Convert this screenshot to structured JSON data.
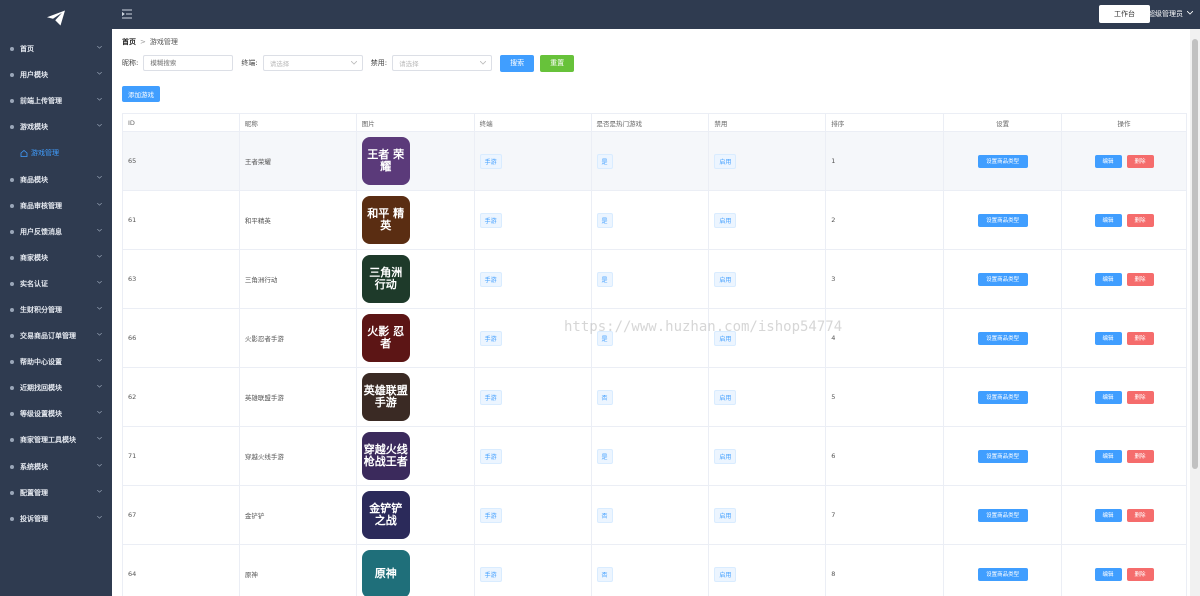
{
  "sidebar": {
    "items": [
      {
        "label": "首页",
        "active": false
      },
      {
        "label": "用户模块",
        "active": false
      },
      {
        "label": "前端上传管理",
        "active": false
      },
      {
        "label": "游戏模块",
        "active": false
      },
      {
        "label": "游戏管理",
        "active": true
      },
      {
        "label": "商品模块",
        "active": false
      },
      {
        "label": "商品审核管理",
        "active": false
      },
      {
        "label": "用户反馈消息",
        "active": false
      },
      {
        "label": "商家模块",
        "active": false
      },
      {
        "label": "实名认证",
        "active": false
      },
      {
        "label": "生财积分管理",
        "active": false
      },
      {
        "label": "交易商品订单管理",
        "active": false
      },
      {
        "label": "帮助中心设置",
        "active": false
      },
      {
        "label": "近期找回模块",
        "active": false
      },
      {
        "label": "等级设置模块",
        "active": false
      },
      {
        "label": "商家管理工具模块",
        "active": false
      },
      {
        "label": "系统模块",
        "active": false
      },
      {
        "label": "配置管理",
        "active": false
      },
      {
        "label": "投诉管理",
        "active": false
      }
    ]
  },
  "topbar": {
    "workbench": "工作台",
    "admin": "超级管理员"
  },
  "breadcrumb": {
    "home": "首页",
    "current": "游戏管理"
  },
  "filters": {
    "name_label": "昵称:",
    "name_placeholder": "模糊搜索",
    "terminal_label": "终端:",
    "terminal_placeholder": "请选择",
    "disable_label": "禁用:",
    "disable_placeholder": "请选择",
    "search_btn": "搜索",
    "reset_btn": "重置"
  },
  "add_btn": "添加游戏",
  "table": {
    "headers": [
      "ID",
      "昵称",
      "图片",
      "终端",
      "是否是热门游戏",
      "禁用",
      "排序",
      "设置",
      "操作"
    ],
    "set_label": "设置商品类型",
    "edit_label": "编辑",
    "delete_label": "删除",
    "rows": [
      {
        "id": "65",
        "name": "王者荣耀",
        "img_text": "王者 荣耀",
        "img_color": "#5b3a7a",
        "terminal": "手游",
        "hot": "是",
        "disabled": "启用",
        "sort": "1"
      },
      {
        "id": "61",
        "name": "和平精英",
        "img_text": "和平 精英",
        "img_color": "#5a2d12",
        "terminal": "手游",
        "hot": "是",
        "disabled": "启用",
        "sort": "2"
      },
      {
        "id": "63",
        "name": "三角洲行动",
        "img_text": "三角洲 行动",
        "img_color": "#1e3a2a",
        "terminal": "手游",
        "hot": "是",
        "disabled": "启用",
        "sort": "3"
      },
      {
        "id": "66",
        "name": "火影忍者手游",
        "img_text": "火影 忍者",
        "img_color": "#5c1515",
        "terminal": "手游",
        "hot": "是",
        "disabled": "启用",
        "sort": "4"
      },
      {
        "id": "62",
        "name": "英雄联盟手游",
        "img_text": "英雄联盟 手游",
        "img_color": "#3a2a24",
        "terminal": "手游",
        "hot": "否",
        "disabled": "启用",
        "sort": "5"
      },
      {
        "id": "71",
        "name": "穿越火线手游",
        "img_text": "穿越火线 枪战王者",
        "img_color": "#3b2a5c",
        "terminal": "手游",
        "hot": "是",
        "disabled": "启用",
        "sort": "6"
      },
      {
        "id": "67",
        "name": "金铲铲",
        "img_text": "金铲铲 之战",
        "img_color": "#2b2a5a",
        "terminal": "手游",
        "hot": "否",
        "disabled": "启用",
        "sort": "7"
      },
      {
        "id": "64",
        "name": "原神",
        "img_text": "原神",
        "img_color": "#1f6f7a",
        "terminal": "手游",
        "hot": "否",
        "disabled": "启用",
        "sort": "8"
      }
    ]
  },
  "watermark": "https://www.huzhan.com/ishop54774",
  "colors": {
    "sidebar_bg": "#2f3b50",
    "primary": "#409eff",
    "success": "#67c23a",
    "danger": "#f56c6c"
  }
}
